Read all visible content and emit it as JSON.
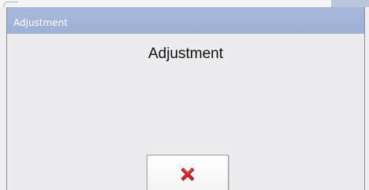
{
  "dialog": {
    "title": "Adjustment",
    "heading": "Adjustment",
    "close_button": {
      "icon": "close-icon",
      "icon_color": "#d9262b"
    }
  },
  "colors": {
    "titlebar": "#a5b6db",
    "title_text": "#ffffff",
    "background": "#ececef"
  }
}
